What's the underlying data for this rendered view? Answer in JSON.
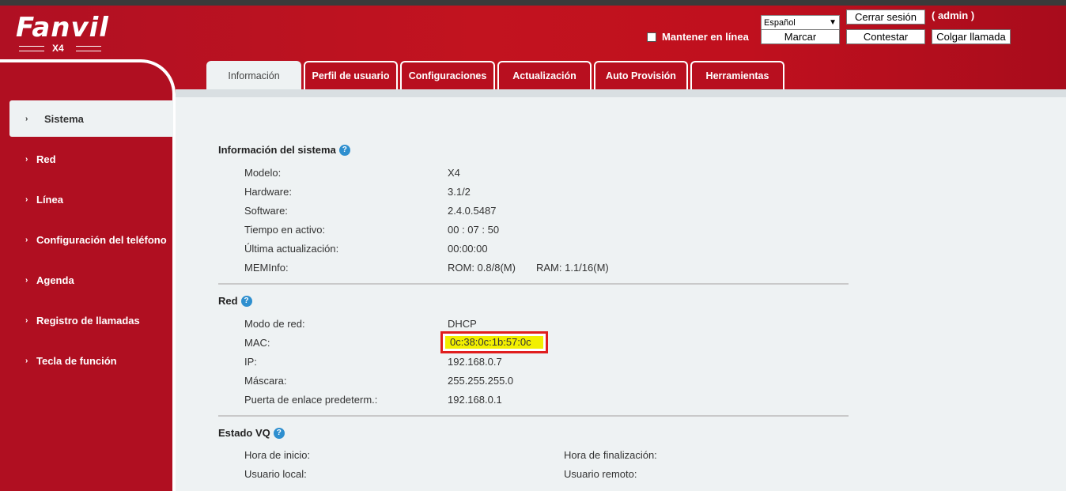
{
  "header": {
    "logo_text": "Fanvil",
    "model": "X4",
    "language": "Español",
    "logout_label": "Cerrar sesión",
    "user": "( admin )",
    "keep_online_label": "Mantener en línea",
    "dial_label": "Marcar",
    "answer_label": "Contestar",
    "hangup_label": "Colgar llamada"
  },
  "tabs": [
    {
      "label": "Información"
    },
    {
      "label": "Perfil de usuario"
    },
    {
      "label": "Configuraciones"
    },
    {
      "label": "Actualización"
    },
    {
      "label": "Auto Provisión"
    },
    {
      "label": "Herramientas"
    }
  ],
  "sidebar": {
    "items": [
      {
        "label": "Sistema"
      },
      {
        "label": "Red"
      },
      {
        "label": "Línea"
      },
      {
        "label": "Configuración del teléfono"
      },
      {
        "label": "Agenda"
      },
      {
        "label": "Registro de llamadas"
      },
      {
        "label": "Tecla de función"
      }
    ]
  },
  "system_info": {
    "title": "Información del sistema",
    "model_label": "Modelo:",
    "model_value": "X4",
    "hardware_label": "Hardware:",
    "hardware_value": "3.1/2",
    "software_label": "Software:",
    "software_value": "2.4.0.5487",
    "uptime_label": "Tiempo en activo:",
    "uptime_value": "00 : 07 : 50",
    "last_update_label": "Última actualización:",
    "last_update_value": "00:00:00",
    "meminfo_label": "MEMInfo:",
    "rom_value": "ROM: 0.8/8(M)",
    "ram_value": "RAM: 1.1/16(M)"
  },
  "network": {
    "title": "Red",
    "mode_label": "Modo de red:",
    "mode_value": "DHCP",
    "mac_label": "MAC:",
    "mac_value": "0c:38:0c:1b:57:0c",
    "ip_label": "IP:",
    "ip_value": "192.168.0.7",
    "mask_label": "Máscara:",
    "mask_value": "255.255.255.0",
    "gateway_label": "Puerta de enlace predeterm.:",
    "gateway_value": "192.168.0.1"
  },
  "vq": {
    "title": "Estado VQ",
    "start_label": "Hora de inicio:",
    "end_label": "Hora de finalización:",
    "local_user_label": "Usuario local:",
    "remote_user_label": "Usuario remoto:"
  },
  "colors": {
    "brand_red": "#c2131f",
    "panel_bg": "#eef2f3",
    "highlight": "#f2ef00",
    "highlight_border": "#e01e1e",
    "help_icon": "#2e8fcf"
  }
}
